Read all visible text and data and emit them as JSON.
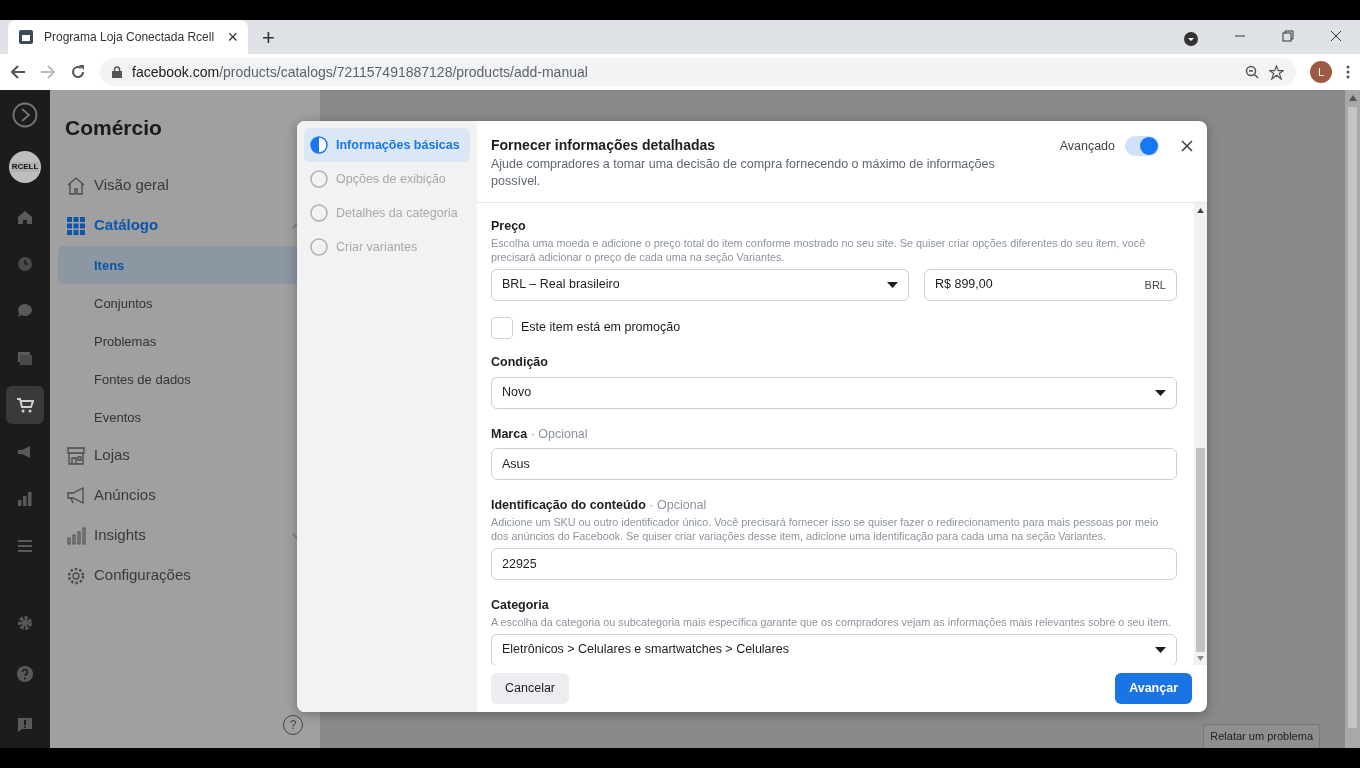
{
  "browser": {
    "tab_title": "Programa Loja Conectada Rcell",
    "close_tab": "×",
    "new_tab": "+",
    "address": {
      "domain": "facebook.com",
      "path": "/products/catalogs/721157491887128/products/add-manual"
    },
    "profile": "L"
  },
  "rail": {
    "logo_text": "RCELL",
    "items": [
      {
        "selected": false
      },
      {
        "selected": false
      },
      {
        "selected": false
      },
      {
        "selected": false
      },
      {
        "selected": true
      },
      {
        "selected": false
      },
      {
        "selected": false
      },
      {
        "selected": false
      }
    ]
  },
  "sidebar": {
    "title": "Comércio",
    "items": [
      {
        "label": "Visão geral",
        "selected": false
      },
      {
        "label": "Catálogo",
        "selected": true,
        "expanded": true,
        "children": [
          {
            "label": "Itens",
            "selected": true
          },
          {
            "label": "Conjuntos",
            "selected": false
          },
          {
            "label": "Problemas",
            "selected": false
          },
          {
            "label": "Fontes de dados",
            "selected": false
          },
          {
            "label": "Eventos",
            "selected": false
          }
        ]
      },
      {
        "label": "Lojas",
        "selected": false
      },
      {
        "label": "Anúncios",
        "selected": false
      },
      {
        "label": "Insights",
        "selected": false,
        "expanded": false
      },
      {
        "label": "Configurações",
        "selected": false
      }
    ]
  },
  "modal": {
    "steps": [
      {
        "label": "Informações básicas",
        "selected": true
      },
      {
        "label": "Opções de exibição",
        "selected": false
      },
      {
        "label": "Detalhes da categoria",
        "selected": false
      },
      {
        "label": "Criar variantes",
        "selected": false
      }
    ],
    "title": "Fornecer informações detalhadas",
    "subtitle": "Ajude compradores a tomar uma decisão de compra fornecendo o máximo de informações possível.",
    "toggle": {
      "label": "Avançado",
      "on": true
    },
    "fields": [
      {
        "kind": "price",
        "label": "Preço",
        "help": "Escolha uma moeda e adicione o preço total do item conforme mostrado no seu site. Se quiser criar opções diferentes do seu item, você precisará adicionar o preço de cada uma na seção Variantes.",
        "currency": "BRL – Real brasileiro",
        "amount": "R$ 899,00",
        "unit": "BRL"
      },
      {
        "kind": "checkbox",
        "label": "Este item está em promoção",
        "checked": false
      },
      {
        "kind": "select",
        "label": "Condição",
        "value": "Novo"
      },
      {
        "kind": "input",
        "label": "Marca",
        "optional": "· Opcional",
        "value": "Asus"
      },
      {
        "kind": "input",
        "label": "Identificação do conteúdo",
        "optional": "· Opcional",
        "help": "Adicione um SKU ou outro identificador único. Você precisará fornecer isso se quiser fazer o redirecionamento para mais pessoas por meio dos anúncios do Facebook. Se quiser criar variações desse item, adicione uma identificação para cada uma na seção Variantes.",
        "value": "22925"
      },
      {
        "kind": "select",
        "label": "Categoria",
        "help": "A escolha da categoria ou subcategoria mais específica garante que os compradores vejam as informações mais relevantes sobre o seu item.",
        "value": "Eletrônicos > Celulares e smartwatches > Celulares"
      }
    ],
    "cancel": "Cancelar",
    "next": "Avançar"
  },
  "help_button": "?",
  "report_button": "Relatar um problema"
}
